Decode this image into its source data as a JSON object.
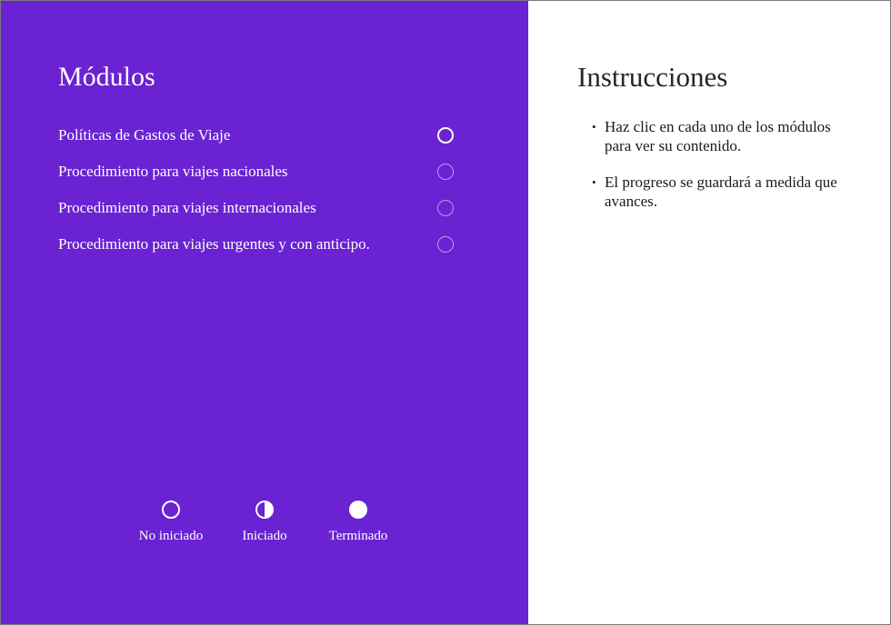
{
  "left_panel": {
    "title": "Módulos",
    "background_color": "#6a22d2",
    "modules": [
      {
        "label": "Políticas de Gastos de Viaje",
        "status": "no-iniciado",
        "icon": "empty-circle-icon"
      },
      {
        "label": "Procedimiento para viajes nacionales",
        "status": "no-iniciado",
        "icon": "empty-circle-icon"
      },
      {
        "label": "Procedimiento para viajes internacionales",
        "status": "no-iniciado",
        "icon": "empty-circle-icon"
      },
      {
        "label": "Procedimiento para viajes urgentes y con anticipo.",
        "status": "no-iniciado",
        "icon": "empty-circle-icon"
      }
    ],
    "legend": [
      {
        "label": "No iniciado",
        "icon": "empty-circle-icon"
      },
      {
        "label": "Iniciado",
        "icon": "half-circle-icon"
      },
      {
        "label": "Terminado",
        "icon": "filled-circle-icon"
      }
    ]
  },
  "right_panel": {
    "title": "Instrucciones",
    "instructions": [
      "Haz clic en cada uno de los módulos para ver su contenido.",
      "El progreso se guardará a medida que avances."
    ]
  }
}
